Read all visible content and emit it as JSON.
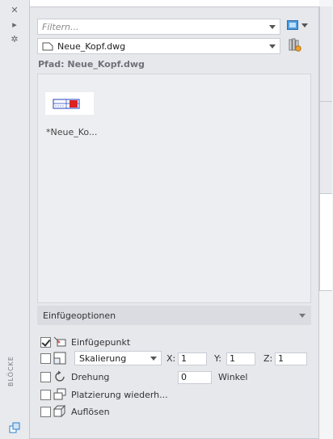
{
  "palette_label": "BLÖCKE",
  "filter": {
    "placeholder": "Filtern..."
  },
  "file_combo": {
    "value": "Neue_Kopf.dwg"
  },
  "path_label": "Pfad: Neue_Kopf.dwg",
  "blocks": [
    {
      "name": "*Neue_Ko..."
    }
  ],
  "insert_options": {
    "title": "Einfügeoptionen",
    "insertion_point": {
      "label": "Einfügepunkt",
      "checked": true
    },
    "scale": {
      "mode": "Skalierung",
      "x_label": "X:",
      "x": "1",
      "y_label": "Y:",
      "y": "1",
      "z_label": "Z:",
      "z": "1"
    },
    "rotation": {
      "label": "Drehung",
      "value": "0",
      "unit": "Winkel"
    },
    "repeat_placement": {
      "label": "Platzierung wiederh..."
    },
    "explode": {
      "label": "Auflösen"
    }
  },
  "colors": {
    "accent": "#2f7fc9",
    "panel": "#e6e8ec"
  }
}
